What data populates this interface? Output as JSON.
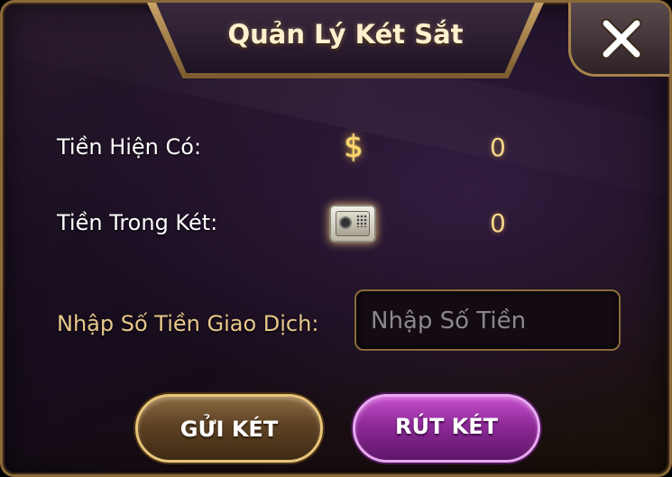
{
  "dialog": {
    "title": "Quản Lý Két Sắt",
    "close_icon": "close-icon"
  },
  "balances": {
    "current_label": "Tiền Hiện Có:",
    "current_value": "0",
    "current_icon": "dollar-icon",
    "safe_label": "Tiền Trong Két:",
    "safe_value": "0",
    "safe_icon": "safe-icon"
  },
  "transaction": {
    "label": "Nhập Số Tiền Giao Dịch:",
    "value": "",
    "placeholder": "Nhập Số Tiền"
  },
  "actions": {
    "deposit_label": "GỬI KÉT",
    "withdraw_label": "RÚT KÉT"
  },
  "colors": {
    "gold_text": "#e8c98c",
    "value_gold": "#f5d58a",
    "deposit_button": "#6e4e2c",
    "withdraw_button": "#a63aae",
    "frame_border": "#8a6a3a"
  }
}
